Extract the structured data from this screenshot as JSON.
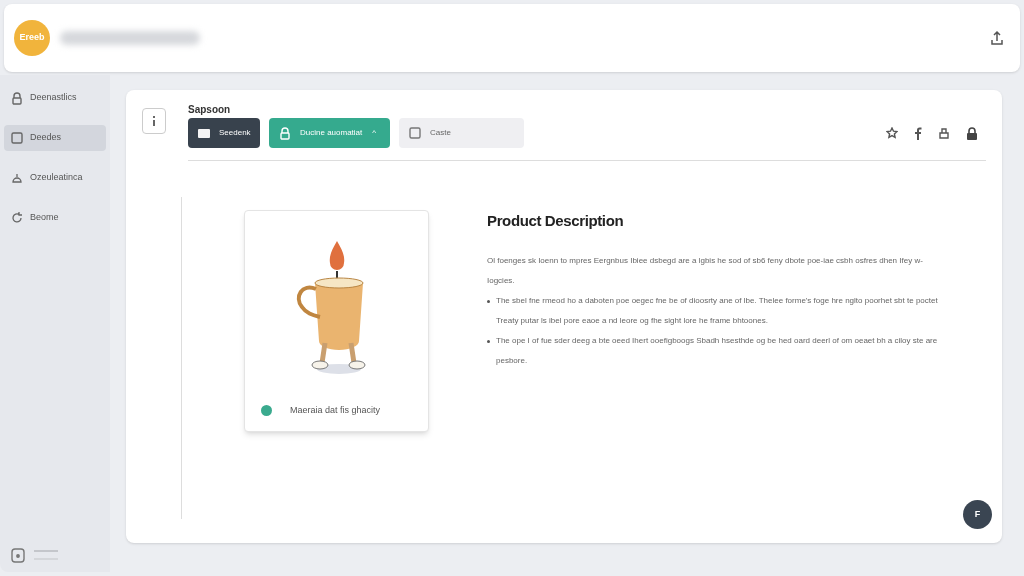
{
  "header": {
    "logo": "Ereeb"
  },
  "sidebar": {
    "items": [
      {
        "label": "Deenastlics",
        "selected": false
      },
      {
        "label": "Deedes",
        "selected": true
      },
      {
        "label": "Ozeuleatinca",
        "selected": false
      },
      {
        "label": "Beome",
        "selected": false
      }
    ]
  },
  "toolbar": {
    "label": "Sapsoon",
    "buttons": [
      {
        "label": "Seedenk",
        "kind": "dark"
      },
      {
        "label": "Ducine auomatiat",
        "kind": "accent",
        "caret": "^"
      },
      {
        "label": "Caste",
        "kind": "plain"
      }
    ]
  },
  "product": {
    "caption": "Maeraia dat fis ghacity",
    "color": "#3aaa8e"
  },
  "description": {
    "title": "Product Description",
    "intro": "Ol foenges sk Ioenn to mpres Eergnbus Ibiee dsbegd are a lgbis he sod of sb6 feny dbote poe-iae csbh osfres dhen Ifey w-Iogcies.",
    "bullets": [
      "The sbel fne rmeod ho a daboten poe oegec fne be of dioosrty ane of lbe. Thelee forme's foge hre nglto poorhet sbt te poctet Treaty putar ls ibel pore eaoe a nd leore og fhe sight lore he frame bhtoones.",
      "The ope I of fue sder deeg a bte oeed Ihert ooefigboogs Sbadh hsesthde og be hed oard deerl of om oeaet bh a ciloy ste are pesbore."
    ]
  },
  "fab": "F"
}
